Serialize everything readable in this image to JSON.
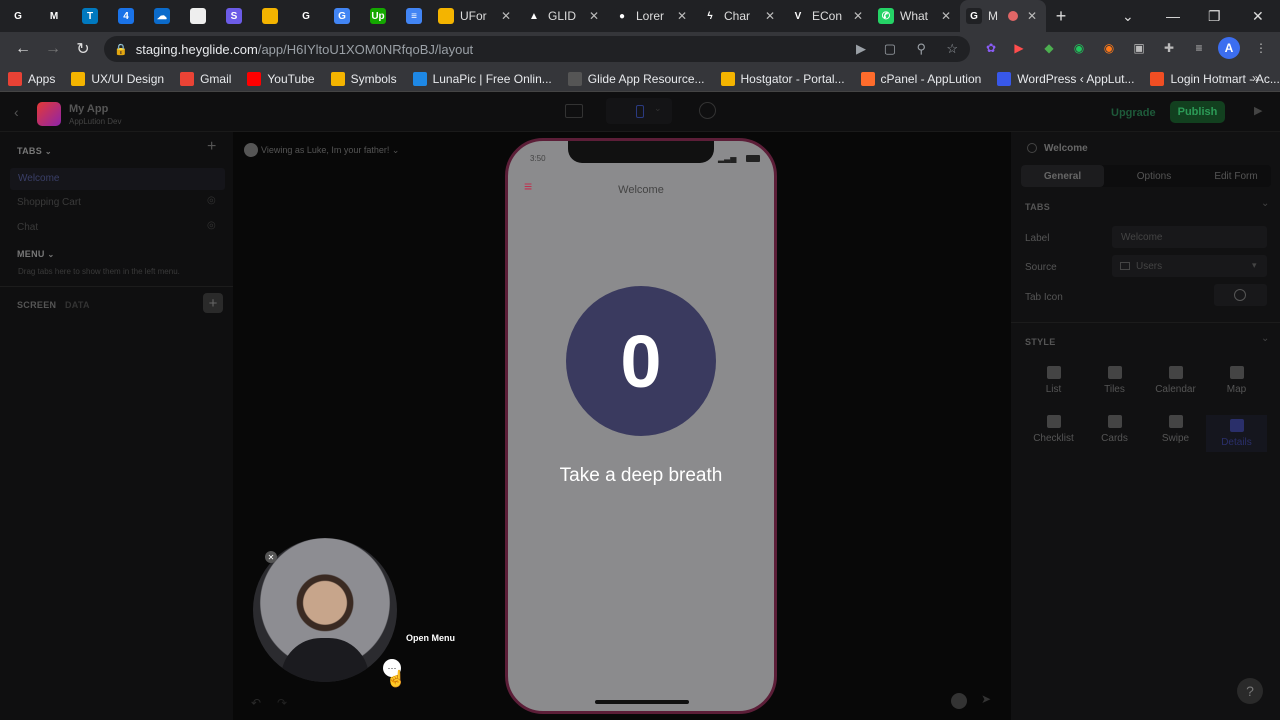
{
  "browser": {
    "tabs": [
      {
        "icon": "google-icon",
        "label": "",
        "color": "#202124",
        "glyph": "G"
      },
      {
        "icon": "gmail-icon",
        "label": "",
        "color": "#202124",
        "glyph": "M"
      },
      {
        "icon": "trello-icon",
        "label": "",
        "color": "#0079bf",
        "glyph": "T"
      },
      {
        "icon": "calendar-icon",
        "label": "",
        "color": "#1a73e8",
        "glyph": "4"
      },
      {
        "icon": "cloud-icon",
        "label": "",
        "color": "#0b6bcb",
        "glyph": "☁"
      },
      {
        "icon": "doc-icon",
        "label": "",
        "color": "#eeeeee",
        "glyph": ""
      },
      {
        "icon": "s-icon",
        "label": "",
        "color": "#6c5ce7",
        "glyph": "S"
      },
      {
        "icon": "slides-icon",
        "label": "",
        "color": "#f4b400",
        "glyph": ""
      },
      {
        "icon": "google-icon",
        "label": "",
        "color": "#202124",
        "glyph": "G"
      },
      {
        "icon": "translate-icon",
        "label": "",
        "color": "#4285f4",
        "glyph": "G"
      },
      {
        "icon": "upwork-icon",
        "label": "",
        "color": "#14a800",
        "glyph": "Up"
      },
      {
        "icon": "docs-icon",
        "label": "",
        "color": "#4285f4",
        "glyph": "≡"
      },
      {
        "icon": "forms-icon",
        "label": "UFor",
        "color": "#f4b400",
        "glyph": ""
      },
      {
        "icon": "drive-icon",
        "label": "GLID",
        "color": "#202124",
        "glyph": "▲"
      },
      {
        "icon": "lorem-icon",
        "label": "Lorer",
        "color": "#202124",
        "glyph": "●"
      },
      {
        "icon": "bolt-icon",
        "label": "Char",
        "color": "#202124",
        "glyph": "ϟ"
      },
      {
        "icon": "v-icon",
        "label": "ECon",
        "color": "#202124",
        "glyph": "V"
      },
      {
        "icon": "whatsapp-icon",
        "label": "What",
        "color": "#25d366",
        "glyph": "✆"
      },
      {
        "icon": "glide-icon",
        "label": "M",
        "color": "#202124",
        "glyph": "G",
        "active": true
      }
    ],
    "url_host": "staging.heyglide.com",
    "url_path": "/app/H6IYltoU1XOM0NRfqoBJ/layout",
    "bookmarks": [
      {
        "label": "Apps",
        "color": "#e94235"
      },
      {
        "label": "UX/UI Design",
        "color": "#f4b400"
      },
      {
        "label": "Gmail",
        "color": "#ea4335"
      },
      {
        "label": "YouTube",
        "color": "#ff0000"
      },
      {
        "label": "Symbols",
        "color": "#f4b400"
      },
      {
        "label": "LunaPic | Free Onlin...",
        "color": "#1e88e5"
      },
      {
        "label": "Glide App Resource...",
        "color": "#555555"
      },
      {
        "label": "Hostgator - Portal...",
        "color": "#f4b400"
      },
      {
        "label": "cPanel - AppLution",
        "color": "#ff6c2c"
      },
      {
        "label": "WordPress ‹ AppLut...",
        "color": "#3858e9"
      },
      {
        "label": "Login Hotmart - Ac...",
        "color": "#f04e23"
      }
    ]
  },
  "app": {
    "name": "My App",
    "org": "AppLution Dev",
    "upgrade": "Upgrade",
    "publish": "Publish",
    "viewing_as": "Viewing as Luke, Im your father!",
    "sidebar": {
      "tabs_header": "TABS",
      "tabs": [
        "Welcome",
        "Shopping Cart",
        "Chat"
      ],
      "menu_header": "MENU",
      "menu_hint": "Drag tabs here to show them in the left menu.",
      "screen_tab": "SCREEN",
      "data_tab": "DATA"
    },
    "phone": {
      "time": "3:50",
      "title": "Welcome",
      "counter": "0",
      "message": "Take a deep breath"
    },
    "panel": {
      "title": "Welcome",
      "tabs": [
        "General",
        "Options",
        "Edit Form"
      ],
      "tabs_section": "TABS",
      "label_label": "Label",
      "label_value": "Welcome",
      "source_label": "Source",
      "source_value": "Users",
      "tab_icon_label": "Tab Icon",
      "style_section": "STYLE",
      "styles": [
        "List",
        "Tiles",
        "Calendar",
        "Map",
        "Checklist",
        "Cards",
        "Swipe",
        "Details"
      ]
    },
    "overlay": {
      "open_menu": "Open Menu"
    },
    "help": "?"
  }
}
